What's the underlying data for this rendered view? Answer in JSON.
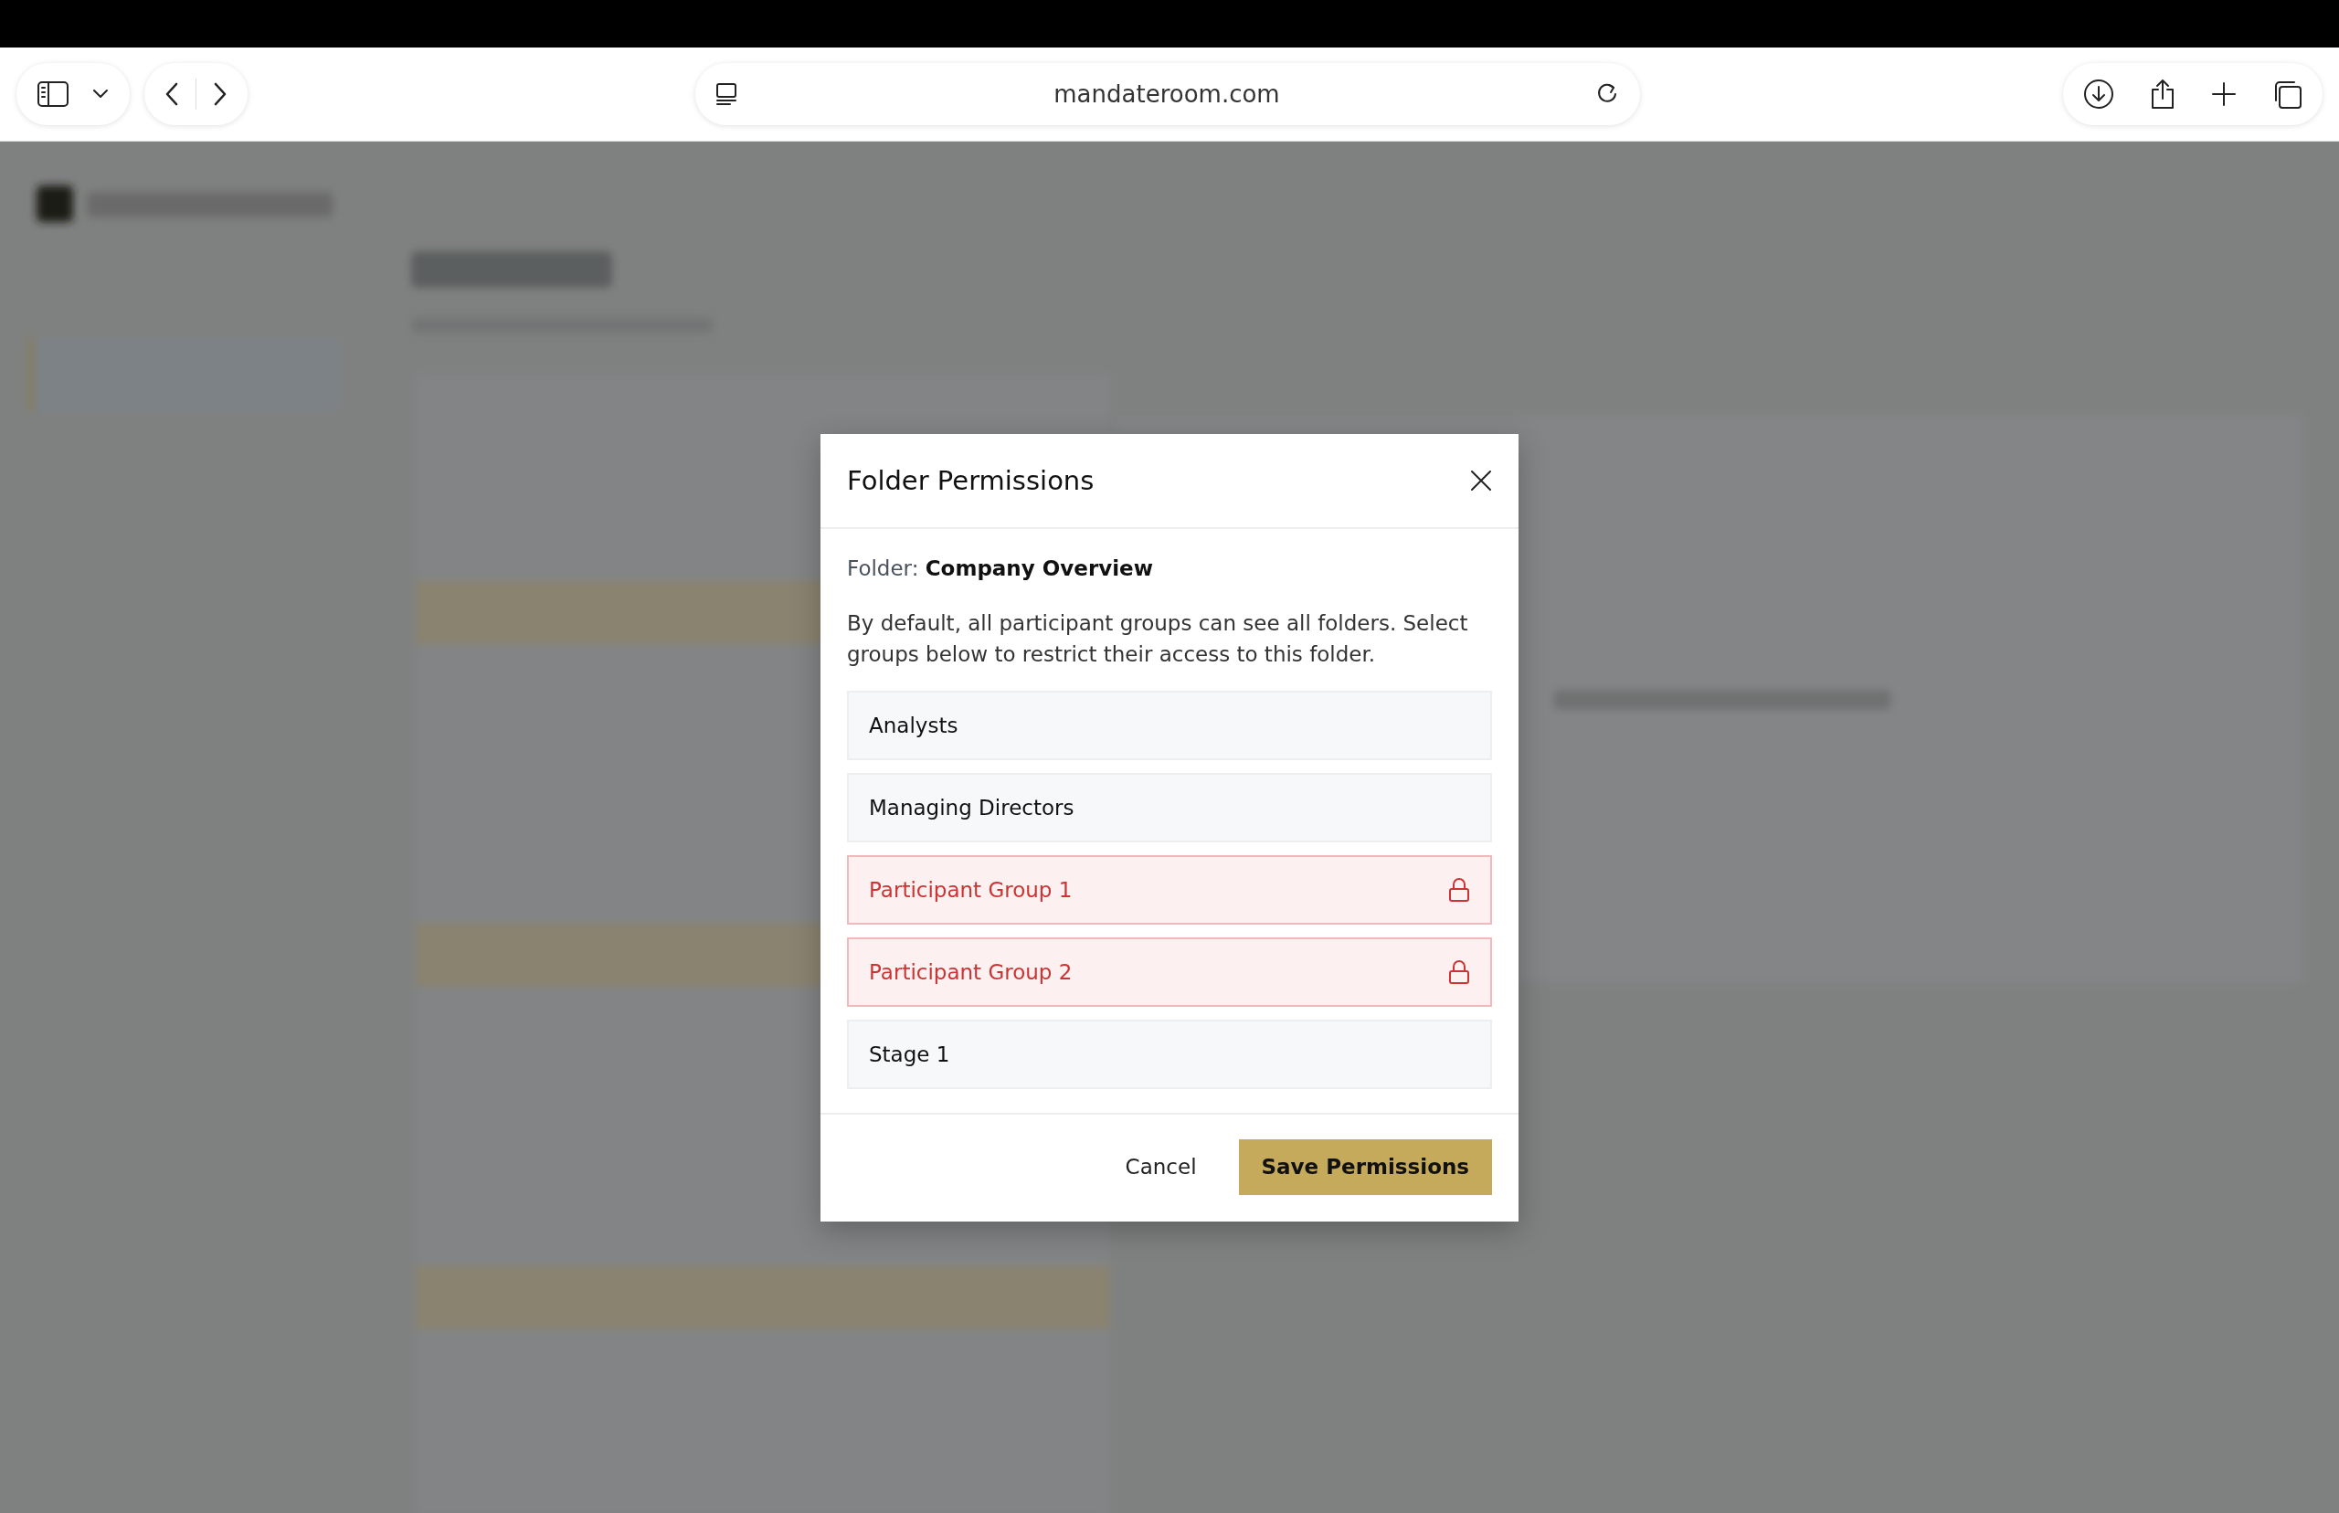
{
  "browser": {
    "url": "mandateroom.com"
  },
  "dialog": {
    "title": "Folder Permissions",
    "folder": "Folder: **Company Overview**",
    "description": "By default, all participant groups can see all folders. Select groups below to restrict their access to this folder.",
    "groups": [
      {
        "name": "Analysts",
        "restricted": false
      },
      {
        "name": "Managing Directors",
        "restricted": false
      },
      {
        "name": "Participant Group 1",
        "restricted": true
      },
      {
        "name": "Participant Group 2",
        "restricted": true
      },
      {
        "name": "Stage 1",
        "restricted": false
      }
    ],
    "buttons": {
      "cancel": "Cancel",
      "save": "Save Permissions"
    }
  }
}
